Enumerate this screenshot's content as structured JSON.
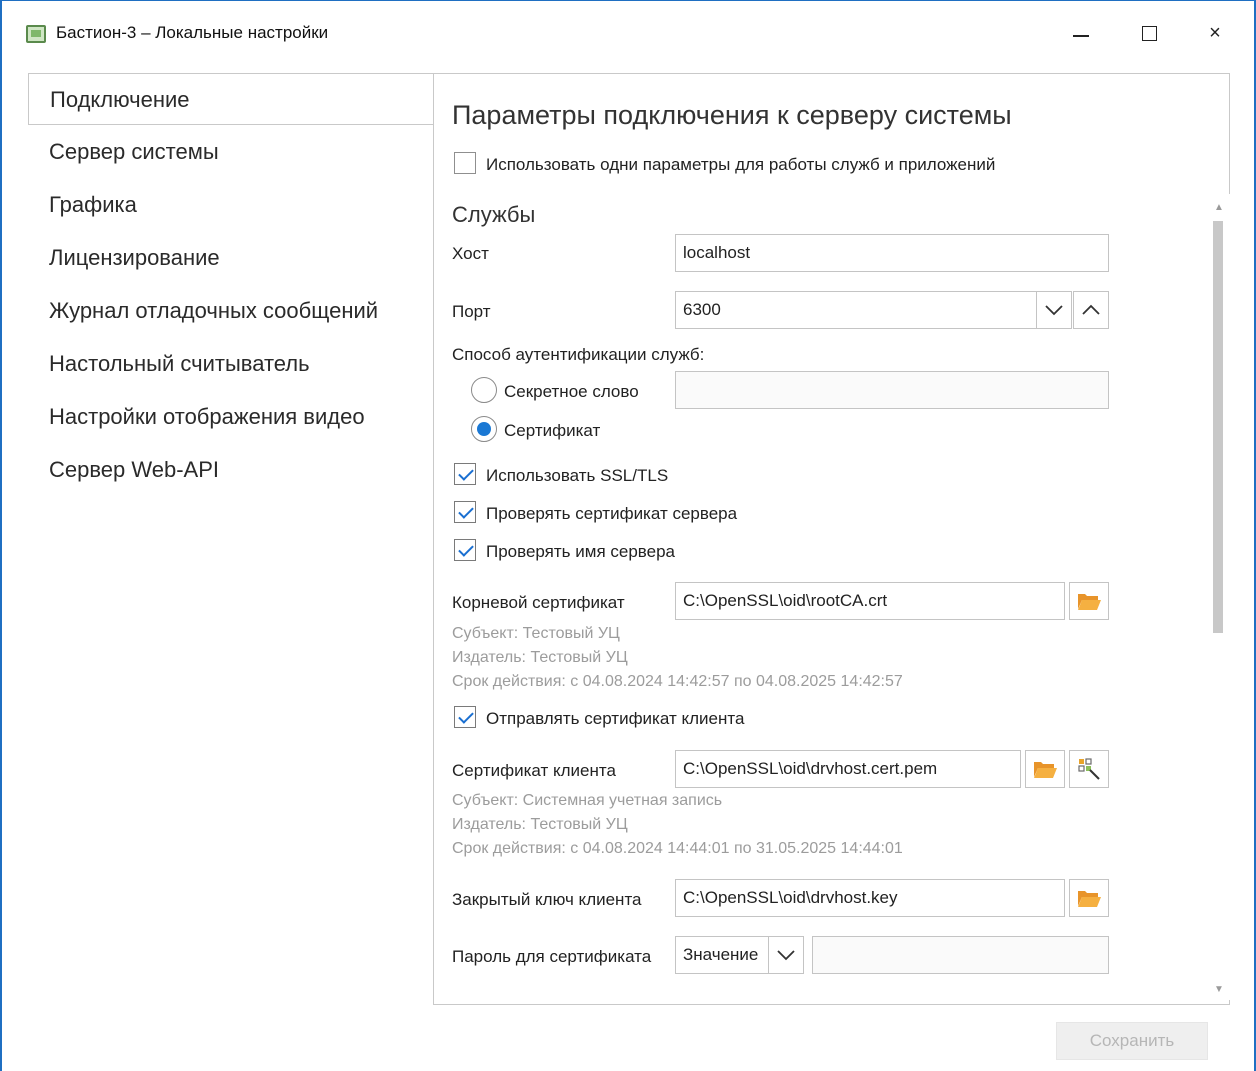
{
  "window": {
    "title": "Бастион-3 – Локальные настройки",
    "icon": "app-monitor-icon",
    "controls": {
      "minimize": "minimize-icon",
      "maximize": "maximize-icon",
      "close": "×"
    }
  },
  "sidebar": {
    "items": [
      {
        "label": "Подключение",
        "selected": true
      },
      {
        "label": "Сервер системы"
      },
      {
        "label": "Графика"
      },
      {
        "label": "Лицензирование"
      },
      {
        "label": "Журнал отладочных сообщений"
      },
      {
        "label": "Настольный считыватель"
      },
      {
        "label": "Настройки отображения видео"
      },
      {
        "label": "Сервер Web-API"
      }
    ]
  },
  "main": {
    "heading": "Параметры подключения к серверу системы",
    "same_params": {
      "label": "Использовать одни параметры для работы служб и приложений",
      "checked": false
    },
    "services": {
      "title": "Службы",
      "host": {
        "label": "Хост",
        "value": "localhost"
      },
      "port": {
        "label": "Порт",
        "value": "6300"
      },
      "auth_label": "Способ аутентификации служб:",
      "auth_secret": {
        "label": "Секретное слово",
        "selected": false,
        "value": ""
      },
      "auth_cert": {
        "label": "Сертификат",
        "selected": true
      },
      "use_ssl": {
        "label": "Использовать SSL/TLS",
        "checked": true
      },
      "verify_cert": {
        "label": "Проверять сертификат сервера",
        "checked": true
      },
      "verify_name": {
        "label": "Проверять имя сервера",
        "checked": true
      },
      "root_cert": {
        "label": "Корневой сертификат",
        "value": "C:\\OpenSSL\\oid\\rootCA.crt",
        "subject": "Субъект: Тестовый УЦ",
        "issuer": "Издатель: Тестовый УЦ",
        "validity": "Срок действия: с 04.08.2024 14:42:57 по 04.08.2025 14:42:57"
      },
      "send_client_cert": {
        "label": "Отправлять сертификат клиента",
        "checked": true
      },
      "client_cert": {
        "label": "Сертификат клиента",
        "value": "C:\\OpenSSL\\oid\\drvhost.cert.pem",
        "subject": "Субъект: Системная учетная запись",
        "issuer": "Издатель: Тестовый УЦ",
        "validity": "Срок действия: с 04.08.2024 14:44:01 по 31.05.2025 14:44:01"
      },
      "private_key": {
        "label": "Закрытый ключ клиента",
        "value": "C:\\OpenSSL\\oid\\drvhost.key"
      },
      "cert_password": {
        "label": "Пароль для сертификата",
        "mode": "Значение",
        "value": ""
      }
    }
  },
  "footer": {
    "save_label": "Сохранить",
    "save_enabled": false
  },
  "colors": {
    "accent": "#1a78d4",
    "folder": "#f0a030",
    "border": "#c4c4c4",
    "disabled_text": "#b6b6b6"
  }
}
